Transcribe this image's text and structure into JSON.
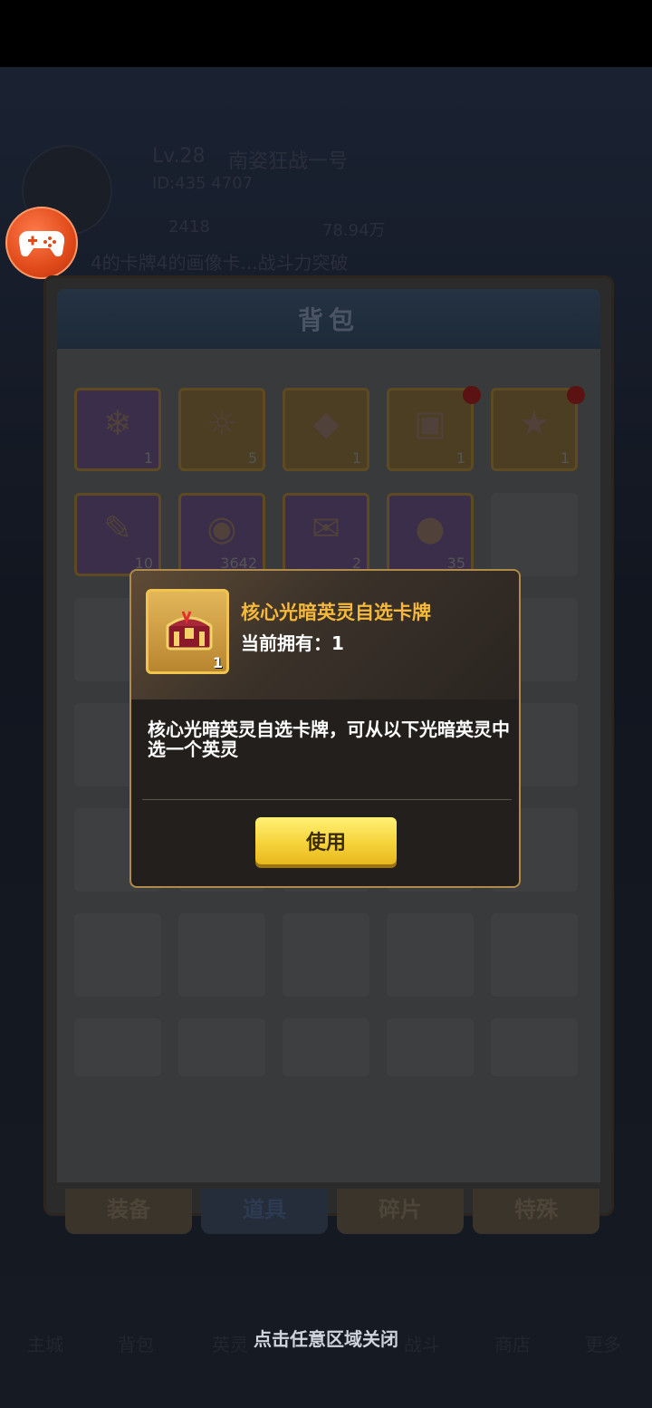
{
  "background": {
    "player_level": "Lv.28",
    "player_name": "南姿狂战一号",
    "player_id": "ID:435 4707",
    "currency_1": "2418",
    "currency_2": "78.94万",
    "notice": "4的卡牌4的画像卡...战斗力突破"
  },
  "bag": {
    "title": "背包",
    "items": [
      {
        "count": "1",
        "icon": "blue-crystal-icon",
        "frame": "purple",
        "red_dot": false
      },
      {
        "count": "5",
        "icon": "sun-emblem-icon",
        "frame": "gold",
        "red_dot": false
      },
      {
        "count": "1",
        "icon": "amber-gem-icon",
        "frame": "gold",
        "red_dot": false
      },
      {
        "count": "1",
        "icon": "treasure-chest-icon",
        "frame": "gold",
        "red_dot": true
      },
      {
        "count": "1",
        "icon": "hero-card-chest-icon",
        "frame": "gold",
        "red_dot": true
      },
      {
        "count": "10",
        "icon": "scroll-icon",
        "frame": "purple",
        "red_dot": false
      },
      {
        "count": "3642",
        "icon": "eye-crystal-icon",
        "frame": "purple",
        "red_dot": false
      },
      {
        "count": "2",
        "icon": "explore-ticket-icon",
        "frame": "purple",
        "red_dot": false
      },
      {
        "count": "35",
        "icon": "red-apple-icon",
        "frame": "purple",
        "red_dot": false
      }
    ],
    "tabs": [
      {
        "label": "装备",
        "active": false
      },
      {
        "label": "道具",
        "active": true
      },
      {
        "label": "碎片",
        "active": false
      },
      {
        "label": "特殊",
        "active": false
      }
    ]
  },
  "bottom_nav": [
    "主城",
    "背包",
    "英灵",
    "战斗",
    "商店",
    "更多"
  ],
  "dialog": {
    "item_name": "核心光暗英灵自选卡牌",
    "owned_label": "当前拥有：1",
    "icon_count": "1",
    "description": "核心光暗英灵自选卡牌，可从以下光暗英灵中选一个英灵",
    "use_button": "使用"
  },
  "close_hint": "点击任意区域关闭",
  "colors": {
    "accent_gold": "#f6b93a",
    "button_yellow": "#f6d33a",
    "dialog_border": "#b08a4a",
    "gamepad_orange": "#e04a1a"
  }
}
